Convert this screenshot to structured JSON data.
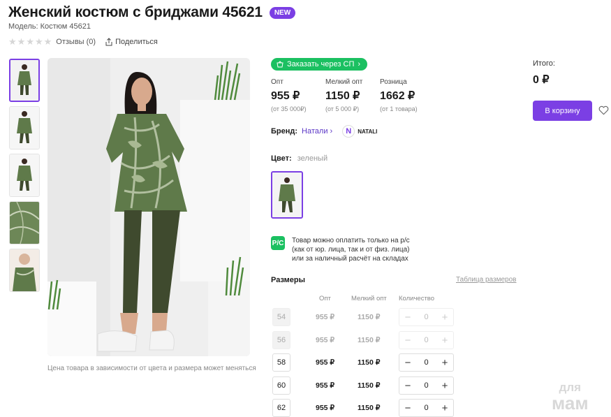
{
  "product": {
    "title": "Женский костюм с бриджами 45621",
    "badge": "NEW",
    "model": "Модель: Костюм 45621",
    "reviews": "Отзывы (0)",
    "share": "Поделиться",
    "rating_stars": 0
  },
  "order_sp_button": "Заказать через СП",
  "prices": [
    {
      "label": "Опт",
      "value": "955 ₽",
      "note": "(от 35 000₽)"
    },
    {
      "label": "Мелкий опт",
      "value": "1150 ₽",
      "note": "(от 5 000 ₽)"
    },
    {
      "label": "Розница",
      "value": "1662 ₽",
      "note": "(от 1 товара)"
    }
  ],
  "brand": {
    "label": "Бренд:",
    "name": "Натали",
    "logo_text": "NATALI"
  },
  "color": {
    "label": "Цвет:",
    "value": "зеленый"
  },
  "payment_note": {
    "icon": "Р/С",
    "lines": [
      "Товар можно оплатить только на р/с",
      "(как от юр. лица, так и от физ. лица)",
      "или за наличный расчёт на складах"
    ]
  },
  "sizes": {
    "title": "Размеры",
    "table_link": "Таблица размеров",
    "headers": {
      "opt": "Опт",
      "small_opt": "Мелкий опт",
      "qty": "Количество"
    },
    "rows": [
      {
        "size": "54",
        "opt": "955 ₽",
        "small_opt": "1150 ₽",
        "qty": "0",
        "available": false
      },
      {
        "size": "56",
        "opt": "955 ₽",
        "small_opt": "1150 ₽",
        "qty": "0",
        "available": false
      },
      {
        "size": "58",
        "opt": "955 ₽",
        "small_opt": "1150 ₽",
        "qty": "0",
        "available": true
      },
      {
        "size": "60",
        "opt": "955 ₽",
        "small_opt": "1150 ₽",
        "qty": "0",
        "available": true
      },
      {
        "size": "62",
        "opt": "955 ₽",
        "small_opt": "1150 ₽",
        "qty": "0",
        "available": true
      }
    ]
  },
  "price_disclaimer": "Цена товара в зависимости от цвета и размера может меняться",
  "summary": {
    "total_label": "Итого:",
    "total_value": "0 ₽",
    "cart_button": "В корзину"
  },
  "watermark": {
    "line1": "для",
    "line2": "мам"
  },
  "colors": {
    "accent": "#7b3fe4",
    "green": "#1bc061",
    "suit": "#5f7a4a",
    "pants": "#3f4a2e"
  }
}
